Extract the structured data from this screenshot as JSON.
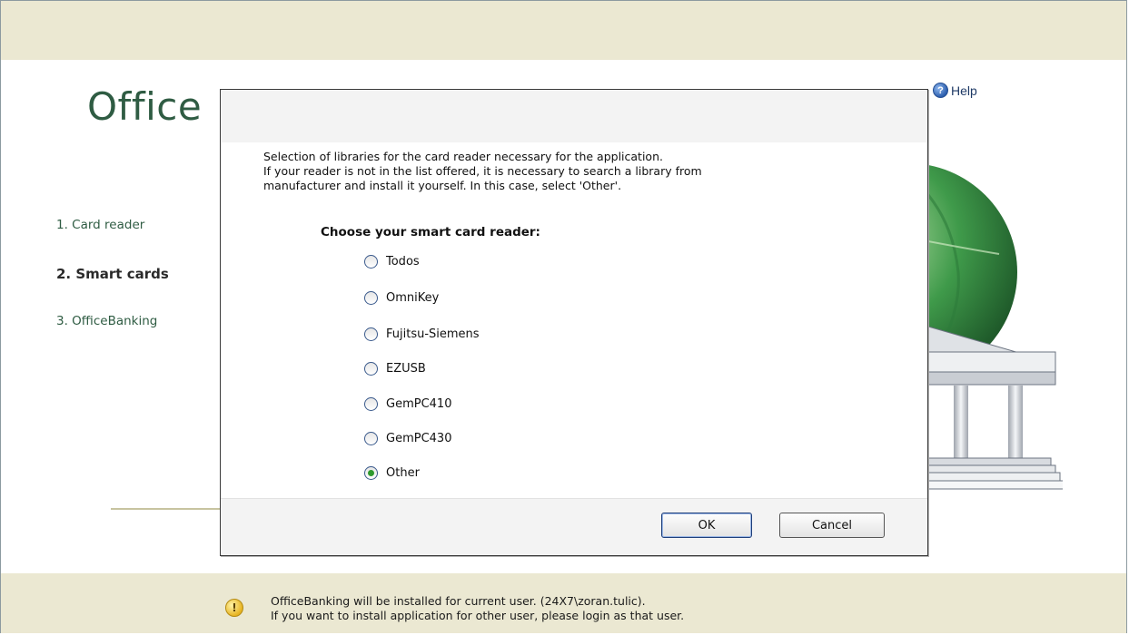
{
  "app": {
    "title": "Office",
    "help_label": "Help"
  },
  "steps": [
    {
      "label": "1. Card reader",
      "state": "done"
    },
    {
      "label": "2. Smart cards",
      "state": "current"
    },
    {
      "label": "3. OfficeBanking",
      "state": "pending"
    }
  ],
  "dialog": {
    "description_lines": [
      "Selection of libraries for the card reader necessary for the application.",
      "If your reader is not in the list offered, it is necessary to search a library from",
      "manufacturer and install it yourself. In this case, select 'Other'."
    ],
    "heading": "Choose your smart card reader:",
    "options": [
      {
        "label": "Todos",
        "checked": false
      },
      {
        "label": "OmniKey",
        "checked": false
      },
      {
        "label": "Fujitsu-Siemens",
        "checked": false
      },
      {
        "label": "EZUSB",
        "checked": false
      },
      {
        "label": "GemPC410",
        "checked": false
      },
      {
        "label": "GemPC430",
        "checked": false
      },
      {
        "label": "Other",
        "checked": true
      }
    ],
    "ok_label": "OK",
    "cancel_label": "Cancel"
  },
  "notice": {
    "line1": "OfficeBanking will be installed  for current user. (24X7\\zoran.tulic).",
    "line2": "If you want to install application for other user, please login as that user."
  },
  "icons": {
    "help": "help-icon",
    "warning": "warning-icon"
  },
  "colors": {
    "band": "#ebe8d2",
    "title_green": "#2f5c43",
    "selected_radio": "#2f9a2f"
  }
}
